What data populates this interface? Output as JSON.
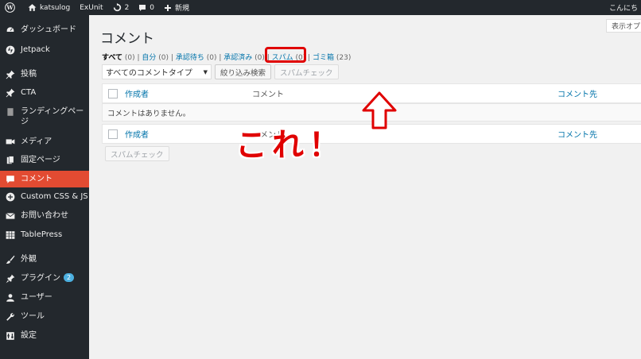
{
  "admin_bar": {
    "site_name": "katsulog",
    "theme_item": "ExUnit",
    "updates_count": "2",
    "comments_count": "0",
    "new_label": "新規",
    "greeting": "こんにち"
  },
  "sidebar": {
    "items": [
      {
        "label": "ダッシュボード",
        "icon": "dashboard-icon"
      },
      {
        "label": "Jetpack",
        "icon": "jetpack-icon"
      },
      {
        "label": "投稿",
        "icon": "pin-icon"
      },
      {
        "label": "CTA",
        "icon": "pin-icon"
      },
      {
        "label": "ランディングページ",
        "icon": "page-icon"
      },
      {
        "label": "メディア",
        "icon": "media-icon"
      },
      {
        "label": "固定ページ",
        "icon": "page-icon"
      },
      {
        "label": "コメント",
        "icon": "comment-icon"
      },
      {
        "label": "Custom CSS & JS",
        "icon": "plus-circle-icon"
      },
      {
        "label": "お問い合わせ",
        "icon": "mail-icon"
      },
      {
        "label": "TablePress",
        "icon": "table-icon"
      },
      {
        "label": "外観",
        "icon": "brush-icon"
      },
      {
        "label": "プラグイン",
        "icon": "plugin-icon",
        "badge": "2"
      },
      {
        "label": "ユーザー",
        "icon": "user-icon"
      },
      {
        "label": "ツール",
        "icon": "wrench-icon"
      },
      {
        "label": "設定",
        "icon": "settings-icon"
      }
    ]
  },
  "main": {
    "screen_options": "表示オプ",
    "title": "コメント",
    "filters": [
      {
        "label": "すべて",
        "count": "(0)"
      },
      {
        "label": "自分",
        "count": "(0)"
      },
      {
        "label": "承認待ち",
        "count": "(0)"
      },
      {
        "label": "承認済み",
        "count": "(0)"
      },
      {
        "label": "スパム",
        "count": "(0)"
      },
      {
        "label": "ゴミ箱",
        "count": "(23)"
      }
    ],
    "comment_type_select": "すべてのコメントタイプ",
    "filter_button": "絞り込み検索",
    "spam_check_button": "スパムチェック",
    "table": {
      "col_author": "作成者",
      "col_comment": "コメント",
      "col_target": "コメント先",
      "empty_message": "コメントはありません。"
    },
    "bottom_spam_check": "スパムチェック"
  },
  "annotation": {
    "text": "これ！",
    "color": "#e00000"
  },
  "colors": {
    "adminbar": "#23282d",
    "sidebar_current": "#e24b32",
    "link": "#0073aa"
  }
}
